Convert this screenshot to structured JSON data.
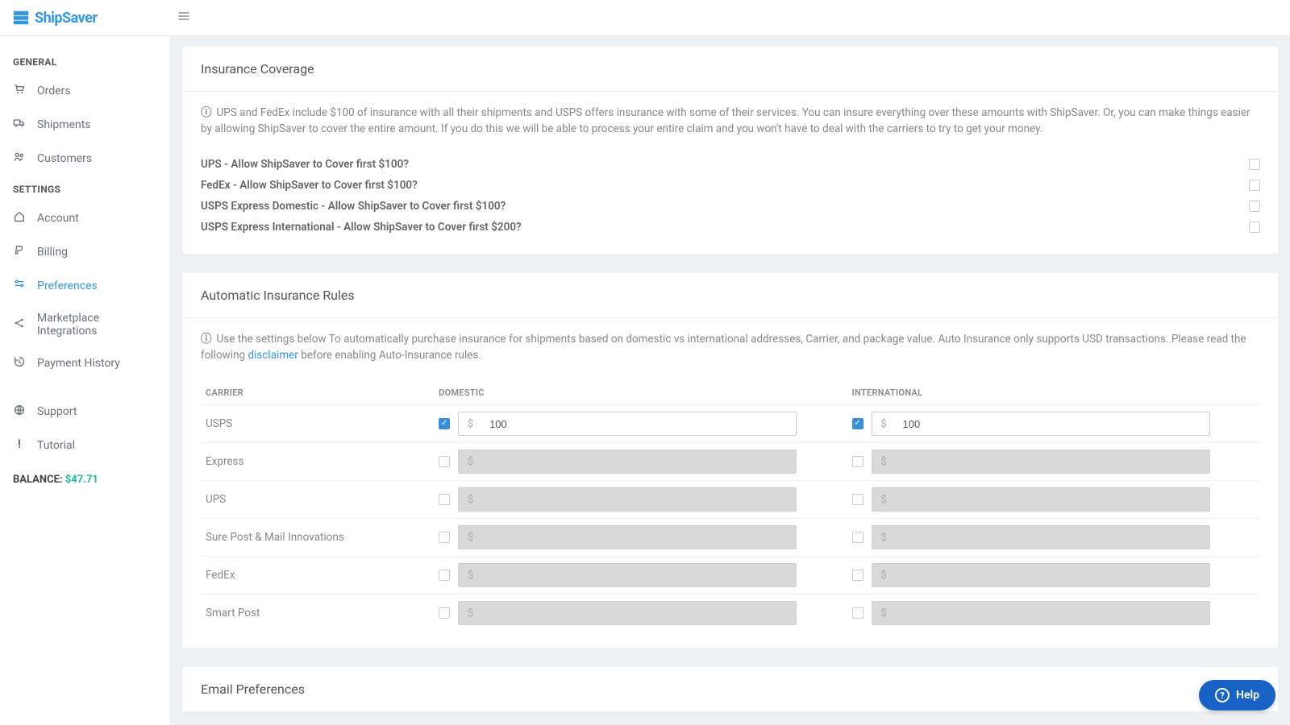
{
  "brand": "ShipSaver",
  "sidebar": {
    "heading_general": "GENERAL",
    "heading_settings": "SETTINGS",
    "items_general": [
      {
        "label": "Orders",
        "icon": "cart"
      },
      {
        "label": "Shipments",
        "icon": "truck"
      },
      {
        "label": "Customers",
        "icon": "users"
      }
    ],
    "items_settings": [
      {
        "label": "Account",
        "icon": "home"
      },
      {
        "label": "Billing",
        "icon": "paypal"
      },
      {
        "label": "Preferences",
        "icon": "sliders",
        "active": true
      },
      {
        "label": "Marketplace Integrations",
        "icon": "share"
      },
      {
        "label": "Payment History",
        "icon": "history"
      }
    ],
    "items_extra": [
      {
        "label": "Support",
        "icon": "globe"
      },
      {
        "label": "Tutorial",
        "icon": "exclaim"
      }
    ],
    "balance_label": "BALANCE:",
    "balance_amount": "$47.71"
  },
  "sections": {
    "insurance": {
      "title": "Insurance Coverage",
      "info": "UPS and FedEx include $100 of insurance with all their shipments and USPS offers insurance with some of their services. You can insure everything over these amounts with ShipSaver. Or, you can make things easier by allowing ShipSaver to cover the entire amount. If you do this we will be able to process your entire claim and you won't have to deal with the carriers to try to get your money.",
      "rows": [
        {
          "label": "UPS - Allow ShipSaver to Cover first $100?",
          "checked": false
        },
        {
          "label": "FedEx - Allow ShipSaver to Cover first $100?",
          "checked": false
        },
        {
          "label": "USPS Express Domestic - Allow ShipSaver to Cover first $100?",
          "checked": false
        },
        {
          "label": "USPS Express International - Allow ShipSaver to Cover first $200?",
          "checked": false
        }
      ]
    },
    "auto": {
      "title": "Automatic Insurance Rules",
      "info_pre": "Use the settings below To automatically purchase insurance for shipments based on domestic vs international addresses, Carrier, and package value. Auto Insurance only supports USD transactions. Please read the following ",
      "disclaimer": "disclaimer",
      "info_post": " before enabling Auto-Insurance rules.",
      "headers": {
        "carrier": "CARRIER",
        "domestic": "DOMESTIC",
        "international": "INTERNATIONAL"
      },
      "rows": [
        {
          "carrier": "USPS",
          "dom_checked": true,
          "dom_value": "100",
          "intl_checked": true,
          "intl_value": "100"
        },
        {
          "carrier": "Express",
          "dom_checked": false,
          "dom_value": "",
          "intl_checked": false,
          "intl_value": ""
        },
        {
          "carrier": "UPS",
          "dom_checked": false,
          "dom_value": "",
          "intl_checked": false,
          "intl_value": ""
        },
        {
          "carrier": "Sure Post & Mail Innovations",
          "dom_checked": false,
          "dom_value": "",
          "intl_checked": false,
          "intl_value": ""
        },
        {
          "carrier": "FedEx",
          "dom_checked": false,
          "dom_value": "",
          "intl_checked": false,
          "intl_value": ""
        },
        {
          "carrier": "Smart Post",
          "dom_checked": false,
          "dom_value": "",
          "intl_checked": false,
          "intl_value": ""
        }
      ]
    },
    "email": {
      "title": "Email Preferences"
    }
  },
  "help": "Help",
  "dollar_sign": "$"
}
